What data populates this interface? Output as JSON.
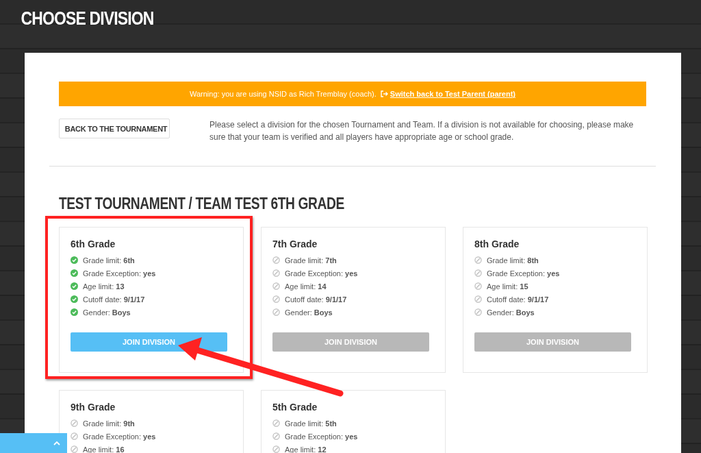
{
  "page_title": "CHOOSE DIVISION",
  "warning": {
    "text": "Warning: you are using NSID as Rich Tremblay (coach).",
    "link": "Switch back to Test Parent (parent)"
  },
  "back_button": "BACK TO THE TOURNAMENT",
  "description": "Please select a division for the chosen Tournament and Team. If a division is not available for choosing, please make sure that your team is verified and all players have appropriate age or school grade.",
  "heading": "TEST TOURNAMENT / TEAM TEST 6TH GRADE",
  "divisions": [
    {
      "name": "6th Grade",
      "highlighted": true,
      "button": {
        "label": "JOIN DIVISION",
        "enabled": true
      },
      "criteria": [
        {
          "label": "Grade limit:",
          "value": "6th",
          "met": true
        },
        {
          "label": "Grade Exception:",
          "value": "yes",
          "met": true
        },
        {
          "label": "Age limit:",
          "value": "13",
          "met": true
        },
        {
          "label": "Cutoff date:",
          "value": "9/1/17",
          "met": true
        },
        {
          "label": "Gender:",
          "value": "Boys",
          "met": true
        }
      ]
    },
    {
      "name": "7th Grade",
      "highlighted": false,
      "button": {
        "label": "JOIN DIVISION",
        "enabled": false
      },
      "criteria": [
        {
          "label": "Grade limit:",
          "value": "7th",
          "met": false
        },
        {
          "label": "Grade Exception:",
          "value": "yes",
          "met": false
        },
        {
          "label": "Age limit:",
          "value": "14",
          "met": false
        },
        {
          "label": "Cutoff date:",
          "value": "9/1/17",
          "met": false
        },
        {
          "label": "Gender:",
          "value": "Boys",
          "met": false
        }
      ]
    },
    {
      "name": "8th Grade",
      "highlighted": false,
      "button": {
        "label": "JOIN DIVISION",
        "enabled": false
      },
      "criteria": [
        {
          "label": "Grade limit:",
          "value": "8th",
          "met": false
        },
        {
          "label": "Grade Exception:",
          "value": "yes",
          "met": false
        },
        {
          "label": "Age limit:",
          "value": "15",
          "met": false
        },
        {
          "label": "Cutoff date:",
          "value": "9/1/17",
          "met": false
        },
        {
          "label": "Gender:",
          "value": "Boys",
          "met": false
        }
      ]
    },
    {
      "name": "9th Grade",
      "highlighted": false,
      "criteria": [
        {
          "label": "Grade limit:",
          "value": "9th",
          "met": false
        },
        {
          "label": "Grade Exception:",
          "value": "yes",
          "met": false
        },
        {
          "label": "Age limit:",
          "value": "16",
          "met": false
        }
      ]
    },
    {
      "name": "5th Grade",
      "highlighted": false,
      "criteria": [
        {
          "label": "Grade limit:",
          "value": "5th",
          "met": false
        },
        {
          "label": "Grade Exception:",
          "value": "yes",
          "met": false
        },
        {
          "label": "Age limit:",
          "value": "12",
          "met": false
        }
      ]
    }
  ]
}
